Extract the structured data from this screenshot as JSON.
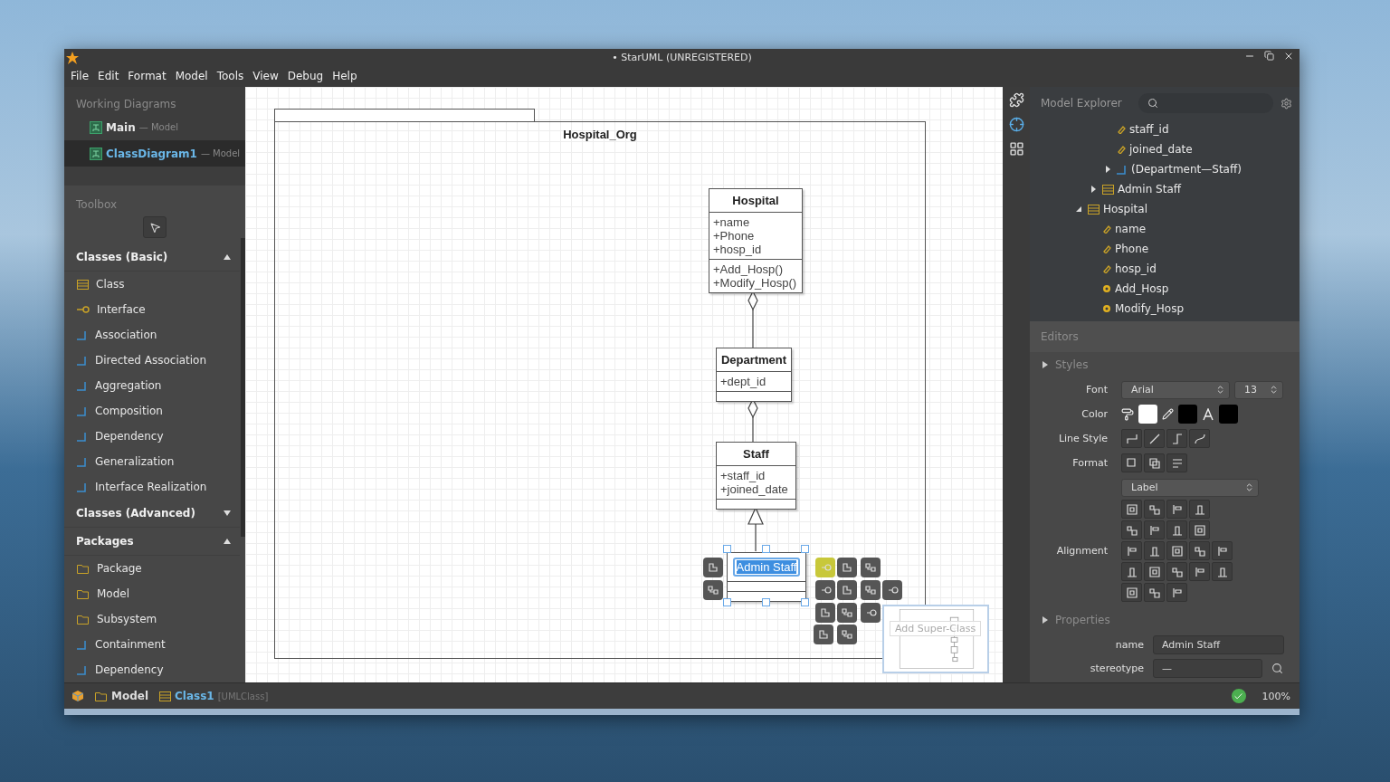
{
  "window": {
    "title": "• StarUML (UNREGISTERED)"
  },
  "menu": [
    "File",
    "Edit",
    "Format",
    "Model",
    "Tools",
    "View",
    "Debug",
    "Help"
  ],
  "working_diagrams": {
    "title": "Working Diagrams",
    "items": [
      {
        "name": "Main",
        "suffix": "— Model",
        "selected": false
      },
      {
        "name": "ClassDiagram1",
        "suffix": "— Model",
        "selected": true
      }
    ]
  },
  "toolbox": {
    "title": "Toolbox",
    "sections": [
      {
        "title": "Classes (Basic)",
        "expanded": true,
        "items": [
          {
            "label": "Class",
            "kind": "class"
          },
          {
            "label": "Interface",
            "kind": "interface"
          },
          {
            "label": "Association",
            "kind": "relation"
          },
          {
            "label": "Directed Association",
            "kind": "relation"
          },
          {
            "label": "Aggregation",
            "kind": "relation"
          },
          {
            "label": "Composition",
            "kind": "relation"
          },
          {
            "label": "Dependency",
            "kind": "relation"
          },
          {
            "label": "Generalization",
            "kind": "relation"
          },
          {
            "label": "Interface Realization",
            "kind": "relation"
          }
        ]
      },
      {
        "title": "Classes (Advanced)",
        "expanded": false
      },
      {
        "title": "Packages",
        "expanded": true,
        "items": [
          {
            "label": "Package",
            "kind": "folder"
          },
          {
            "label": "Model",
            "kind": "folder"
          },
          {
            "label": "Subsystem",
            "kind": "folder"
          },
          {
            "label": "Containment",
            "kind": "relation"
          },
          {
            "label": "Dependency",
            "kind": "relation"
          }
        ]
      }
    ]
  },
  "diagram": {
    "package": "Hospital_Org",
    "classes": [
      {
        "name": "Hospital",
        "selected": false,
        "attributes": [
          "+name",
          "+Phone",
          "+hosp_id"
        ],
        "operations": [
          "+Add_Hosp()",
          "+Modify_Hosp()"
        ]
      },
      {
        "name": "Department",
        "selected": false,
        "attributes": [
          "+dept_id"
        ]
      },
      {
        "name": "Staff",
        "selected": false,
        "attributes": [
          "+staff_id",
          "+joined_date"
        ]
      },
      {
        "name": "Admin Staff",
        "selected": true
      }
    ],
    "relations": [
      {
        "kind": "aggregation"
      },
      {
        "kind": "aggregation"
      },
      {
        "kind": "generalization"
      }
    ],
    "tooltip": "Add Super-Class"
  },
  "explorer": {
    "title": "Model Explorer",
    "tree": [
      {
        "children": [
          {
            "children": [
              {
                "name": "staff_id",
                "kind": "attribute"
              },
              {
                "name": "joined_date",
                "kind": "attribute"
              },
              {
                "name": "(Department—Staff)",
                "kind": "association",
                "expanded": false
              }
            ]
          },
          {
            "name": "Admin Staff",
            "kind": "class",
            "expanded": false
          }
        ]
      },
      {
        "name": "Hospital",
        "kind": "class",
        "expanded": true,
        "children": [
          {
            "name": "name",
            "kind": "attribute"
          },
          {
            "name": "Phone",
            "kind": "attribute"
          },
          {
            "name": "hosp_id",
            "kind": "attribute"
          },
          {
            "name": "Add_Hosp",
            "kind": "operation"
          },
          {
            "name": "Modify_Hosp",
            "kind": "operation"
          }
        ]
      }
    ]
  },
  "editors": {
    "title": "Editors",
    "styles_title": "Styles",
    "font_label": "Font",
    "font": "Arial",
    "size": "13",
    "color_label": "Color",
    "colors": [
      {
        "kind": "fill",
        "color": "#ffffff"
      },
      {
        "kind": "line",
        "color": "#000000"
      },
      {
        "kind": "font",
        "color": "#000000"
      }
    ],
    "line_style_label": "Line Style",
    "format_label": "Format",
    "format_select": "Label",
    "alignment_label": "Alignment",
    "properties_title": "Properties",
    "fields": [
      {
        "label": "name",
        "value": "Admin Staff"
      },
      {
        "label": "stereotype",
        "value": "—"
      }
    ]
  },
  "status_bar": {
    "path": [
      {
        "kind": "model",
        "label": "Model"
      },
      {
        "kind": "class",
        "label": "Class1",
        "type": "[UMLClass]"
      }
    ],
    "zoom": "100%"
  }
}
